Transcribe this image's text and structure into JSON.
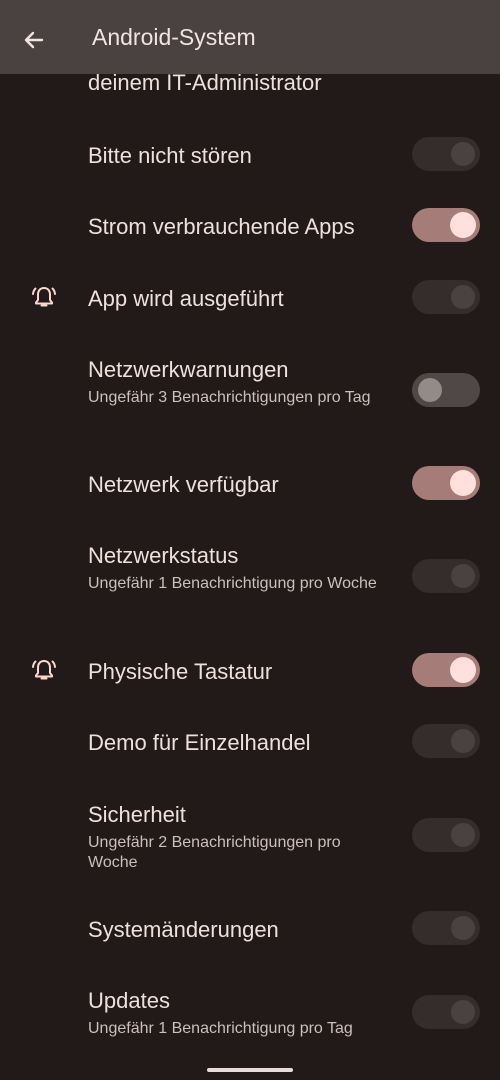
{
  "header": {
    "title": "Android-System",
    "back_icon": "arrow-back-icon"
  },
  "partial_text": "deinem IT-Administrator",
  "channels": [
    {
      "title": "Bitte nicht stören",
      "subtitle": "",
      "icon": "",
      "enabled": false,
      "dimmed": true
    },
    {
      "title": "Strom verbrauchende Apps",
      "subtitle": "",
      "icon": "",
      "enabled": true,
      "dimmed": false
    },
    {
      "title": "App wird ausgeführt",
      "subtitle": "",
      "icon": "bell-alert-icon",
      "enabled": false,
      "dimmed": true
    },
    {
      "title": "Netzwerkwarnungen",
      "subtitle": "Ungefähr 3 Benachrichtigungen pro Tag",
      "icon": "",
      "enabled": false,
      "dimmed": false
    },
    {
      "title": "Netzwerk verfügbar",
      "subtitle": "",
      "icon": "",
      "enabled": true,
      "dimmed": false
    },
    {
      "title": "Netzwerkstatus",
      "subtitle": "Ungefähr 1 Benachrichtigung pro Woche",
      "icon": "",
      "enabled": false,
      "dimmed": true
    },
    {
      "title": "Physische Tastatur",
      "subtitle": "",
      "icon": "bell-alert-icon",
      "enabled": true,
      "dimmed": false
    },
    {
      "title": "Demo für Einzelhandel",
      "subtitle": "",
      "icon": "",
      "enabled": false,
      "dimmed": true
    },
    {
      "title": "Sicherheit",
      "subtitle": "Ungefähr 2 Benachrichtigungen pro Woche",
      "icon": "",
      "enabled": false,
      "dimmed": true
    },
    {
      "title": "Systemänderungen",
      "subtitle": "",
      "icon": "",
      "enabled": false,
      "dimmed": true
    },
    {
      "title": "Updates",
      "subtitle": "Ungefähr 1 Benachrichtigung pro Tag",
      "icon": "",
      "enabled": false,
      "dimmed": true
    }
  ],
  "colors": {
    "background": "#211a18",
    "app_bar": "#4a4240",
    "toggle_on_track": "#a57c78",
    "toggle_on_thumb": "#ffe0dc",
    "text_primary": "#efe0dc",
    "text_secondary": "#cdbfbb"
  }
}
